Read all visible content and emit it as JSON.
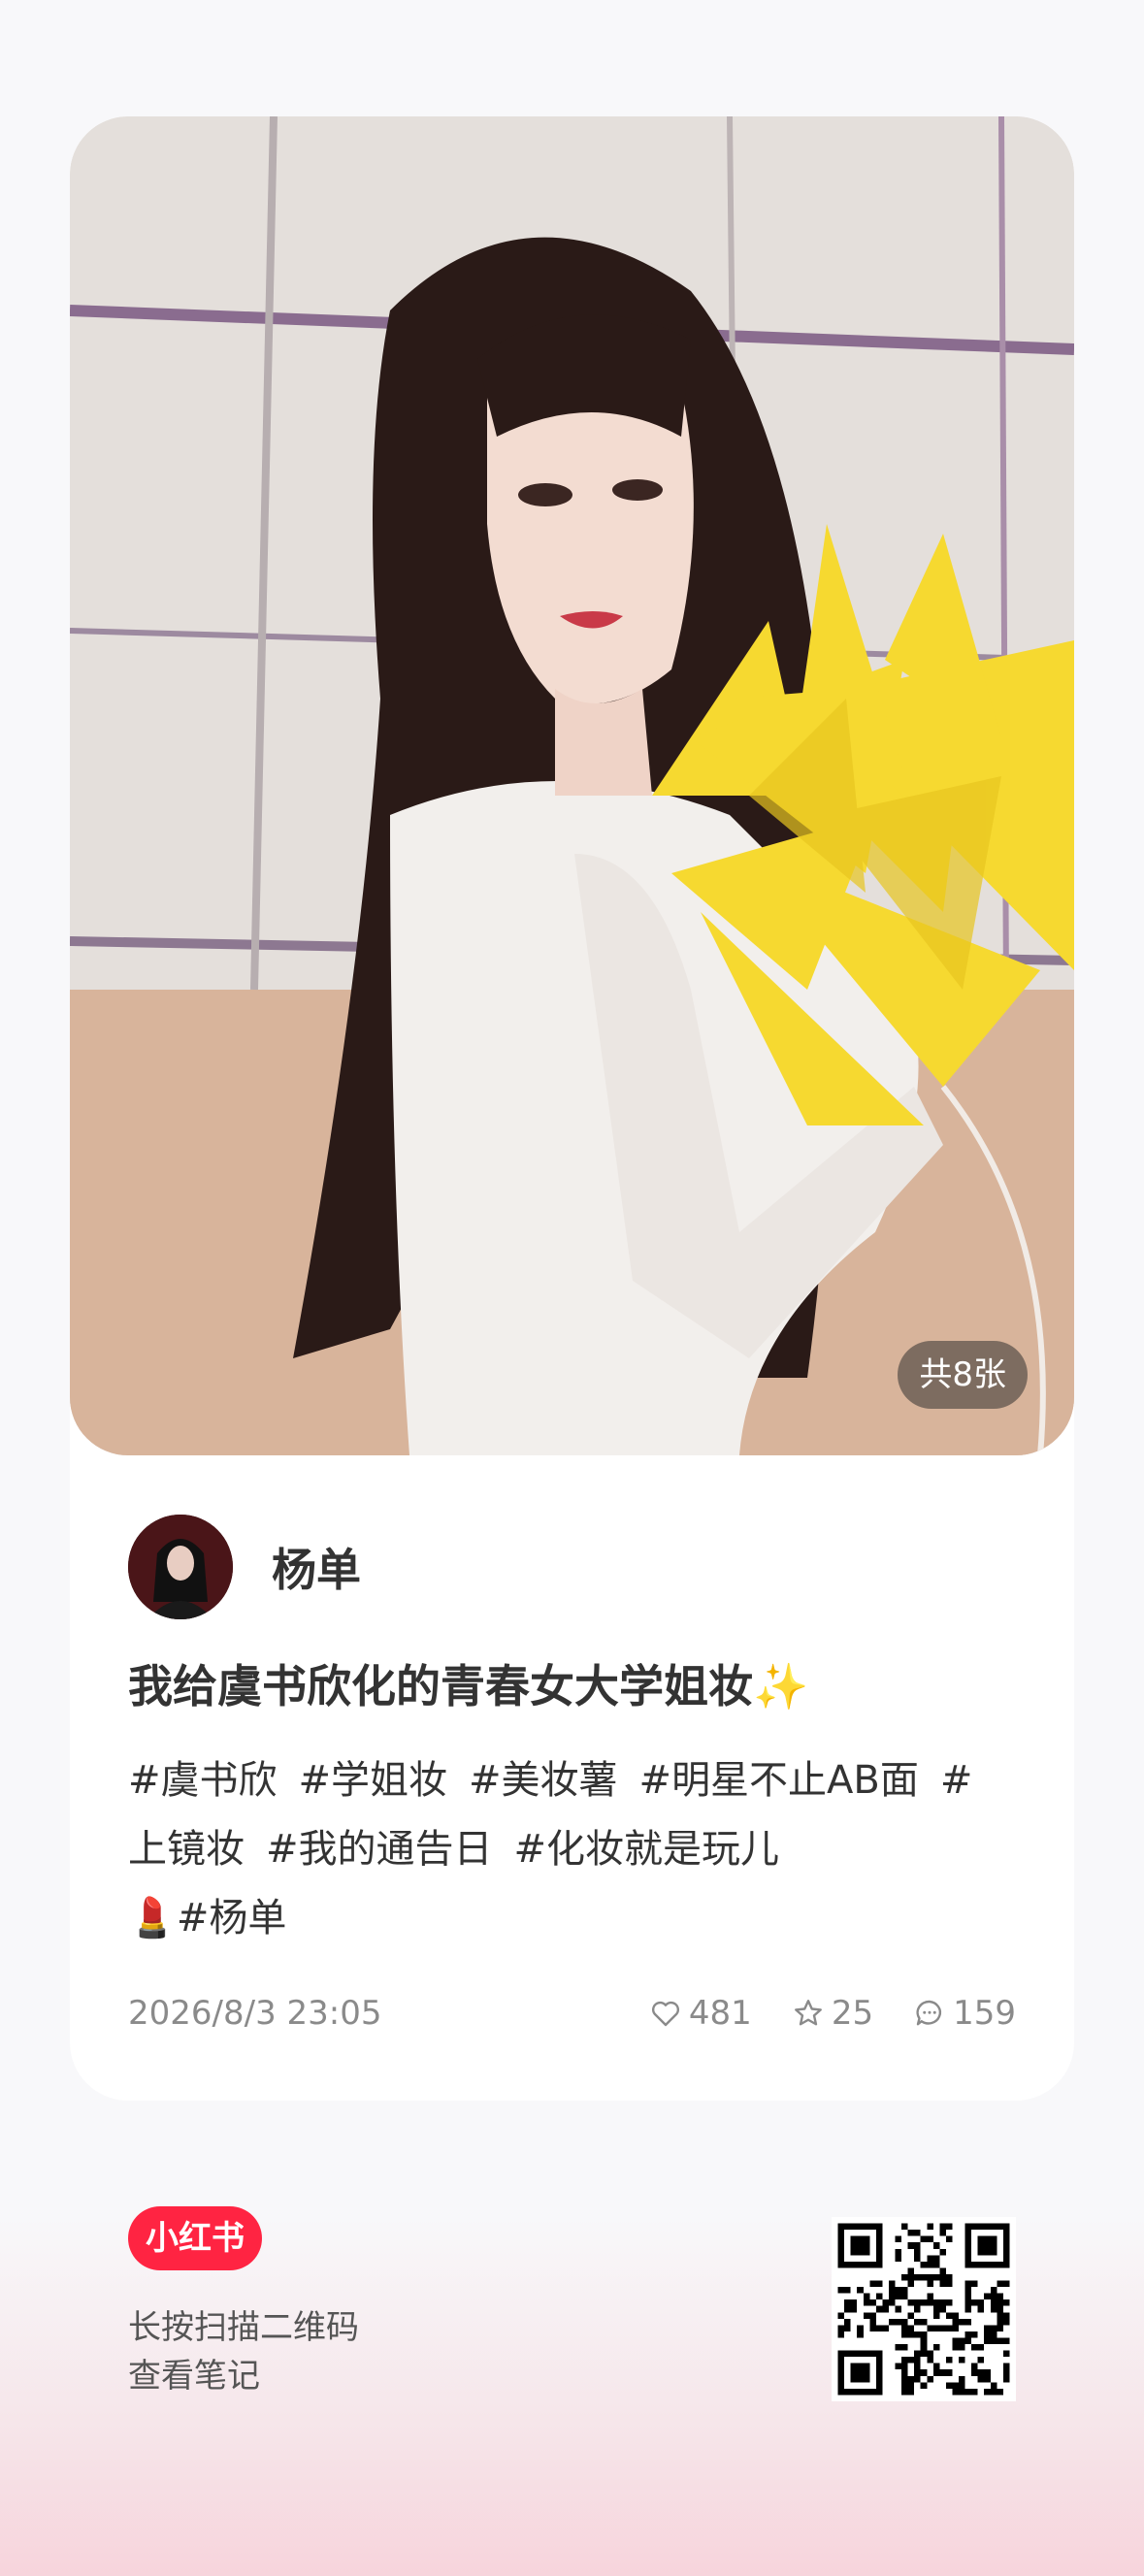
{
  "photo": {
    "count_label": "共8张",
    "description": ""
  },
  "author": {
    "name": "杨单"
  },
  "note": {
    "title": "我给虞书欣化的青春女大学姐妆✨",
    "tags_line1": [
      "#虞书欣",
      "#学姐妆",
      "#美妆薯",
      "#明星不止AB面",
      "#"
    ],
    "tags_line2": [
      "上镜妆",
      "#我的通告日",
      "#化妆就是玩儿"
    ],
    "tags_line3_emoji": "💄",
    "tags_line3_tag": "#杨单",
    "date": "2026/8/3 23:05",
    "likes": "481",
    "collects": "25",
    "comments": "159"
  },
  "footer": {
    "brand": "小红书",
    "line1": "长按扫描二维码",
    "line2": "查看笔记"
  },
  "colors": {
    "brand": "#ff2442",
    "text": "#333333",
    "meta": "#8a8a8a"
  }
}
